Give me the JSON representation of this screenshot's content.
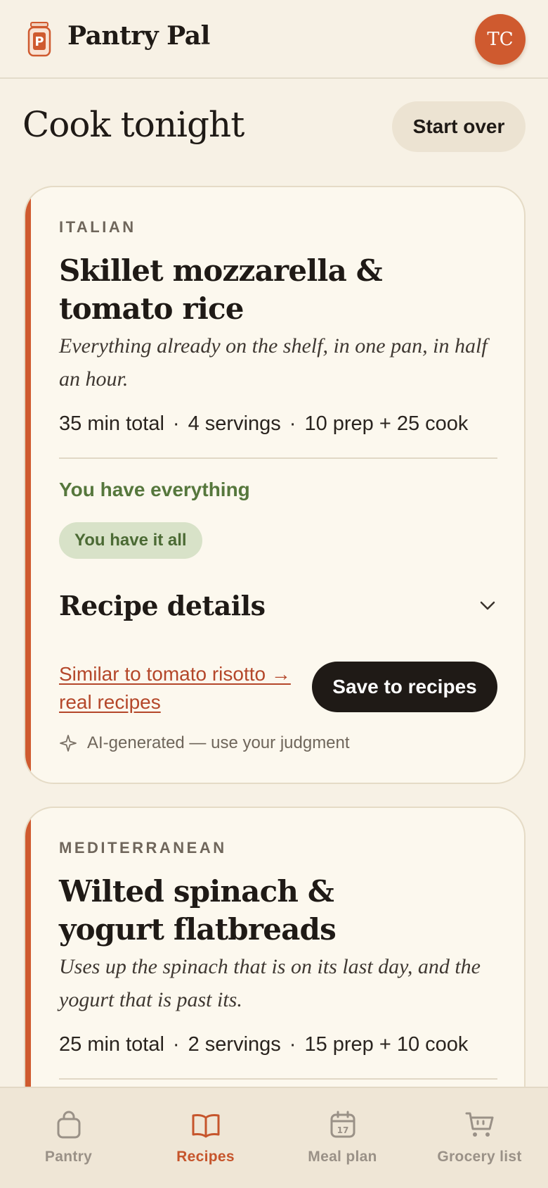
{
  "header": {
    "app_title": "Pantry Pal",
    "avatar_initials": "TC"
  },
  "page": {
    "title": "Cook tonight",
    "start_over_label": "Start over"
  },
  "recipes": [
    {
      "cuisine": "ITALIAN",
      "title": "Skillet mozzarella & tomato rice",
      "description": "Everything already on the shelf, in one pan, in half an hour.",
      "total": "35 min total",
      "servings": "4 servings",
      "timing": "10 prep + 25 cook",
      "have_heading": "You have everything",
      "have_badge": "You have it all",
      "details_label": "Recipe details",
      "similar_link": "Similar to tomato risotto → real recipes",
      "save_label": "Save to recipes",
      "ai_note": "AI-generated — use your judgment"
    },
    {
      "cuisine": "MEDITERRANEAN",
      "title": "Wilted spinach & yogurt flatbreads",
      "description": "Uses up the spinach that is on its last day, and the yogurt that is past its.",
      "total": "25 min total",
      "servings": "2 servings",
      "timing": "15 prep + 10 cook"
    }
  ],
  "meta_separator": "·",
  "nav": {
    "items": [
      {
        "label": "Pantry",
        "icon": "bag-icon",
        "active": false
      },
      {
        "label": "Recipes",
        "icon": "book-icon",
        "active": true
      },
      {
        "label": "Meal plan",
        "icon": "calendar-icon",
        "active": false,
        "badge": "17"
      },
      {
        "label": "Grocery list",
        "icon": "cart-icon",
        "active": false
      }
    ]
  },
  "colors": {
    "accent": "#cf5a2f",
    "background": "#f7f1e5",
    "card": "#fcf8ee",
    "success_text": "#56773c",
    "success_bg": "#d8e2c8",
    "link": "#b4472a",
    "dark_button": "#1f1a16"
  }
}
